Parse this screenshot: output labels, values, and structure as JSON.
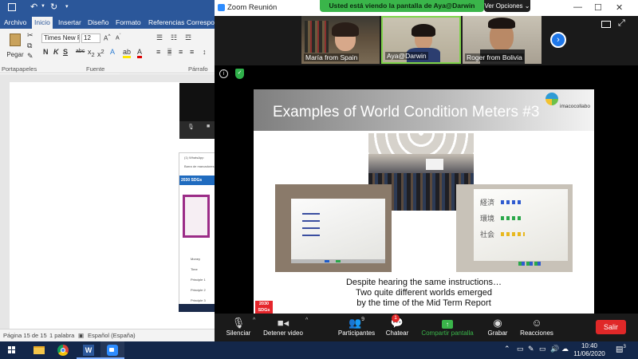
{
  "word": {
    "tabs": [
      "Archivo",
      "Inicio",
      "Insertar",
      "Diseño",
      "Formato",
      "Referencias",
      "Correspon"
    ],
    "active_tab": "Inicio",
    "font_name": "Times New R",
    "font_size": "12",
    "paste_label": "Pegar",
    "groups": {
      "clipboard": "Portapapeles",
      "font": "Fuente",
      "paragraph": "Párrafo"
    },
    "status": {
      "page": "Página 15 de 15",
      "words": "1 palabra",
      "language": "Español (España)"
    },
    "mini": {
      "whatsapp": "(1) WhatsApp",
      "bookmark": "Barra de marcadores",
      "sdgs": "2030 SDGs",
      "rows": [
        "Money",
        "Time",
        "Principle 1",
        "Principle 2",
        "Principle 3"
      ]
    }
  },
  "zoom": {
    "window_title": "Zoom Reunión",
    "share_banner": "Usted está viendo la pantalla de Aya@Darwin",
    "view_options": "Ver Opciones",
    "participants": [
      {
        "name": "María from Spain"
      },
      {
        "name": "Aya@Darwin",
        "active": true
      },
      {
        "name": "Roger from Bolivia"
      }
    ],
    "slide": {
      "title": "Examples of World Condition Meters #3",
      "logo": "imacocollabo",
      "caption": [
        "Despite hearing the same instructions…",
        "Two quite different worlds emerged",
        "by the time of the Mid Term Report"
      ],
      "badge": "2030 SDGs",
      "whiteboard_kanji": [
        "経済",
        "環境",
        "社会"
      ]
    },
    "toolbar": {
      "mute": "Silenciar",
      "stop_video": "Detener video",
      "participants": "Participantes",
      "participants_count": "9",
      "chat": "Chatear",
      "chat_badge": "1",
      "share": "Compartir pantalla",
      "record": "Grabar",
      "reactions": "Reacciones",
      "leave": "Salir"
    }
  },
  "taskbar": {
    "time": "10:40",
    "date": "11/06/2020",
    "notifications": "3"
  },
  "colors": {
    "word_blue": "#2b579a",
    "zoom_green": "#3ab54a",
    "leave_red": "#e02828",
    "taskbar": "#13274a"
  }
}
